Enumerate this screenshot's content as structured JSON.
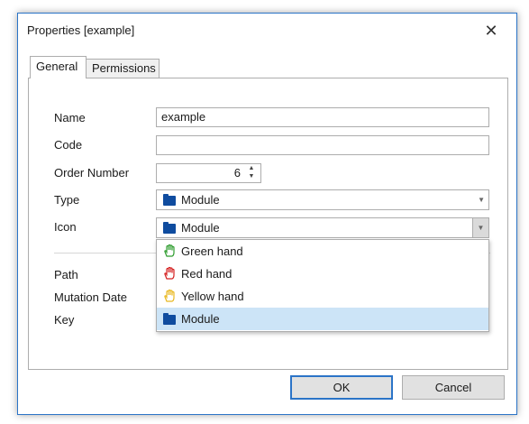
{
  "window": {
    "title": "Properties [example]",
    "close_glyph": "✕"
  },
  "tabs": [
    {
      "label": "General",
      "active": true
    },
    {
      "label": "Permissions",
      "active": false
    }
  ],
  "form": {
    "name_label": "Name",
    "name_value": "example",
    "code_label": "Code",
    "code_value": "",
    "order_label": "Order Number",
    "order_value": "6",
    "type_label": "Type",
    "type_value": "Module",
    "icon_label": "Icon",
    "icon_value": "Module",
    "path_label": "Path",
    "mutation_label": "Mutation Date",
    "key_label": "Key"
  },
  "icon_dropdown": {
    "options": [
      {
        "label": "Green hand",
        "icon": "hand-icon",
        "color": "#2e9c2e"
      },
      {
        "label": "Red hand",
        "icon": "hand-icon",
        "color": "#d42020"
      },
      {
        "label": "Yellow hand",
        "icon": "hand-icon",
        "color": "#e8b820"
      },
      {
        "label": "Module",
        "icon": "folder-icon",
        "color": "#0f4c9f",
        "selected": true
      }
    ]
  },
  "buttons": {
    "ok": "OK",
    "cancel": "Cancel"
  },
  "colors": {
    "accent": "#2b74c7",
    "selection": "#cce4f7",
    "folder": "#0f4c9f"
  }
}
